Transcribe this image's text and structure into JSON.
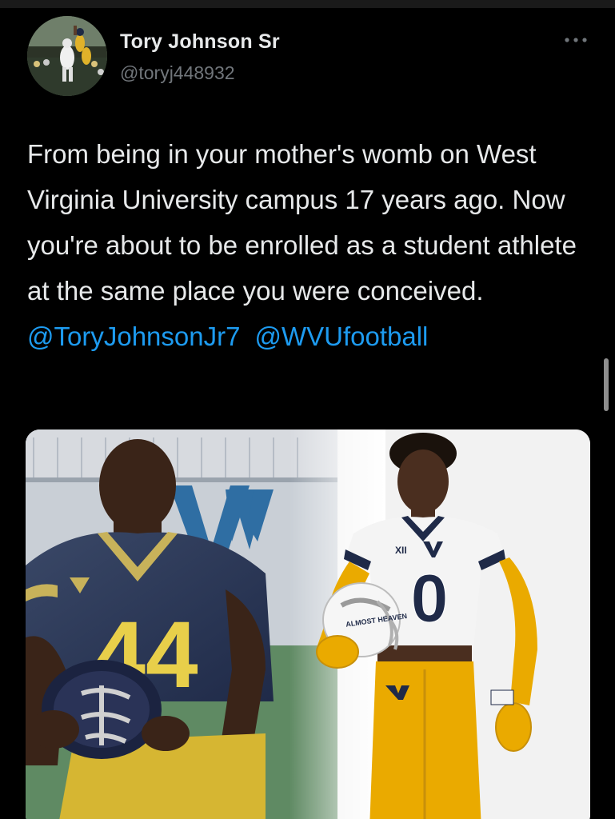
{
  "tweet": {
    "display_name": "Tory Johnson Sr",
    "handle": "@toryj448932",
    "more_icon": "more-horizontal-icon",
    "text": "From being in your mother's womb on West Virginia University campus 17 years ago. Now you're about to be enrolled as a student athlete at the same place you were conceived.",
    "mentions": [
      "@ToryJohnsonJr7",
      "@WVUfootball"
    ]
  },
  "media": {
    "left_jersey_number": "44",
    "right_jersey_number": "0",
    "collar_mark": "XII",
    "helmet_text": "ALMOST HEAVEN"
  },
  "colors": {
    "background": "#000000",
    "text": "#e7e9ea",
    "secondary": "#71767b",
    "link": "#1d9bf0",
    "wvu_gold": "#eaaa00",
    "wvu_navy": "#002855"
  }
}
